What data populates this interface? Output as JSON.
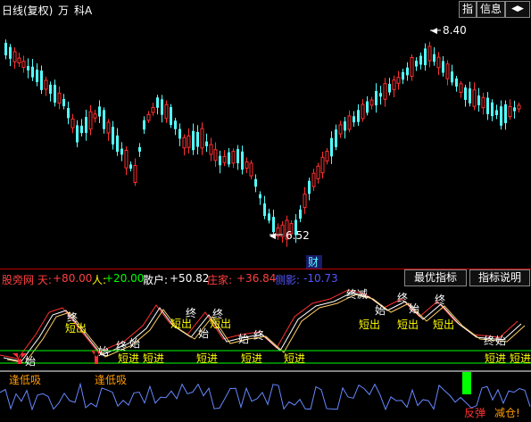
{
  "topbar": {
    "period": "日线(复权)",
    "unit": "万",
    "subject": "科A",
    "btn_zhi": "指",
    "btn_info": "信息",
    "btn_nav": "◀▶"
  },
  "price_chart": {
    "high_label": "8.40",
    "low_label": "6.52",
    "marker_cai": "财"
  },
  "indicator_bar": {
    "name": "股旁网 天:",
    "tian_val": "+80.00",
    "ren_label": "人:",
    "ren_val": "+20.00",
    "sanhu_label": "散户:",
    "sanhu_val": "+50.82",
    "zhuangjia_label": "庄家:",
    "zhuangjia_val": "+36.84",
    "cemian_label": "侧影:",
    "cemian_val": "-10.73",
    "btn_best": "最优指标",
    "btn_help": "指标说明"
  },
  "signals": {
    "zhong": "终",
    "shi": "始",
    "duanchu": "短出",
    "duanjin": "短进",
    "fengdixi": "逢低吸",
    "fantan": "反弹",
    "jiancang": "减仓!",
    "zhongjian": "终减"
  },
  "colors": {
    "up": "#ff3030",
    "down": "#54ffff",
    "signal_yellow": "#ffff00",
    "signal_green": "#00ff00",
    "orange": "#ff9900"
  }
}
